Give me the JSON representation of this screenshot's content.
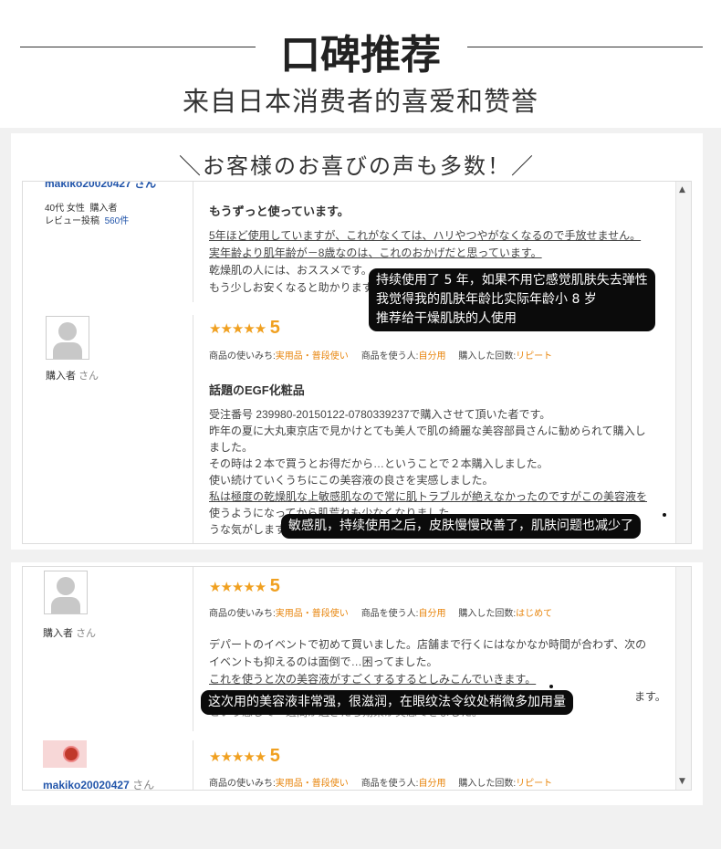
{
  "header": {
    "title": "口碑推荐",
    "subtitle": "来自日本消费者的喜爱和赞誉"
  },
  "banner": "＼お客様のお喜びの声も多数！／",
  "review1": {
    "username_cut": "makiko20020427 さん",
    "age_gender": "40代 女性",
    "type": "購入者",
    "posts_label": "レビュー投稿",
    "posts_count": "560件",
    "headline": "もうずっと使っています。",
    "lines": [
      "5年ほど使用していますが、これがなくては、ハリやつやがなくなるので手放せません。",
      "実年齢より肌年齢が－8歳なのは、これのおかげだと思っています。",
      "乾燥肌の人には、おススメです。",
      "もう少しお安くなると助かります。"
    ],
    "bubble": [
      "持续使用了 5 年，如果不用它感觉肌肤失去弹性",
      "我觉得我的肌肤年龄比实际年龄小 8 岁",
      "推荐给干燥肌肤的人使用"
    ]
  },
  "review2": {
    "user": "購入者",
    "san": "さん",
    "stars": "★★★★★",
    "score": "5",
    "usage_label": "商品の使いみち:",
    "usage_value": "実用品・普段使い",
    "user_label": "商品を使う人:",
    "user_value": "自分用",
    "count_label": "購入した回数:",
    "count_value": "リピート",
    "headline": "話題のEGF化粧品",
    "lines": [
      "受注番号 239980-20150122-0780339237で購入させて頂いた者です。",
      "昨年の夏に大丸東京店で見かけとても美人で肌の綺麗な美容部員さんに勧められて購入し",
      "ました。",
      "その時は２本で買うとお得だから…ということで２本購入しました。",
      "使い続けていくうちにこの美容液の良さを実感しました。",
      "私は極度の乾燥肌な上敏感肌なので常に肌トラブルが絶えなかったのですがこの美容液を",
      "使うようになってから肌荒れも少なくなりました",
      "うな気がします。"
    ],
    "bubble": "敏感肌，持续使用之后，皮肤慢慢改善了，肌肤问题也减少了"
  },
  "review3": {
    "user": "購入者",
    "san": "さん",
    "stars": "★★★★★",
    "score": "5",
    "usage_label": "商品の使いみち:",
    "usage_value": "実用品・普段使い",
    "user_label": "商品を使う人:",
    "user_value": "自分用",
    "count_label": "購入した回数:",
    "count_value": "はじめて",
    "lines": [
      "デパートのイベントで初めて買いました。店舗まで行くにはなかなか時間が合わず、次の",
      "イベントも抑えるのは面倒で…困ってました。",
      "これを使うと次の美容液がすごくするするとしみこんでいきます。",
      "ます。",
      "という感じで一週間が過ぎたら効果が実感できました。"
    ],
    "bubble": "这次用的美容液非常强，很滋润，在眼纹法令纹处稍微多加用量"
  },
  "review4": {
    "user": "makiko20020427",
    "san": "さん",
    "stars": "★★★★★",
    "score": "5",
    "usage_label": "商品の使いみち:",
    "usage_value": "実用品・普段使い",
    "user_label": "商品を使う人:",
    "user_value": "自分用",
    "count_label": "購入した回数:",
    "count_value": "リピート"
  },
  "scroll": {
    "up": "▲",
    "down": "▼"
  }
}
